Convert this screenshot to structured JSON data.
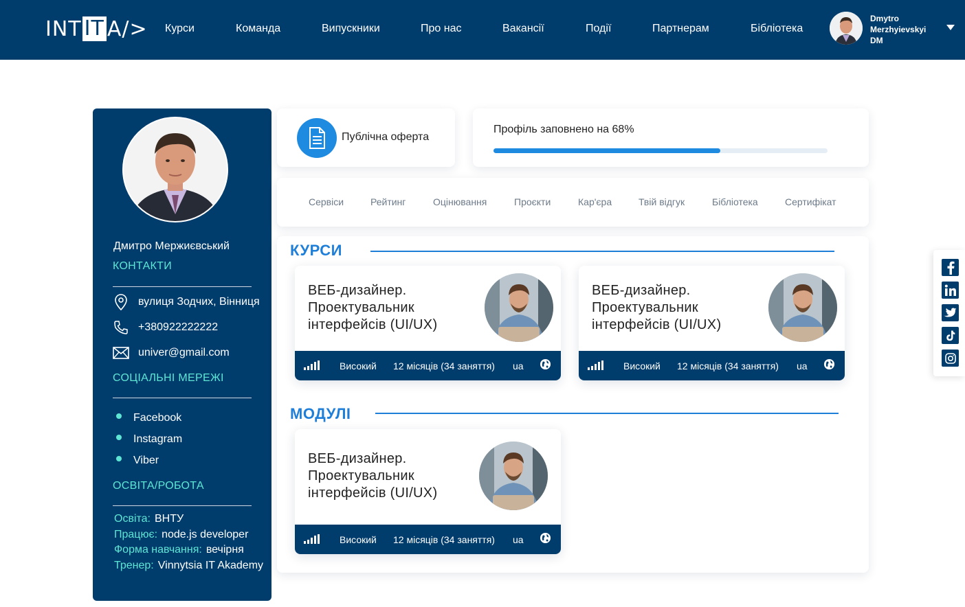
{
  "nav": {
    "logo_left": "INT",
    "logo_box": "IT",
    "logo_right": "A/>",
    "items": [
      "Курси",
      "Команда",
      "Випускники",
      "Про нас",
      "Вакансії",
      "Події",
      "Партнерам",
      "Бібліотека"
    ],
    "user_first": "Dmytro",
    "user_last": "Merzhyievskyi",
    "user_initials": "DM"
  },
  "sidebar": {
    "name": "Дмитро Мержиєвський",
    "contacts_heading": "КОНТАКТИ",
    "address": "вулиця Зодчих, Вінниця",
    "phone": "+380922222222",
    "email": "univer@gmail.com",
    "social_heading": "СОЦІАЛЬНІ МЕРЕЖІ",
    "social": [
      "Facebook",
      "Instagram",
      "Viber"
    ],
    "edu_heading": "ОСВІТА/РОБОТА",
    "info": [
      {
        "label": "Освіта:",
        "value": "ВНТУ"
      },
      {
        "label": "Працює:",
        "value": "node.js developer"
      },
      {
        "label": "Форма навчання:",
        "value": "вечірня"
      },
      {
        "label": "Тренер:",
        "value": "Vinnytsia IT Akademy"
      }
    ]
  },
  "offer": {
    "label": "Публічна оферта"
  },
  "profile": {
    "label": "Профіль заповнено на 68%",
    "percent": 68
  },
  "tabs": [
    "Сервіси",
    "Рейтинг",
    "Оцінювання",
    "Проєкти",
    "Кар'єра",
    "Твій відгук",
    "Бібліотека",
    "Сертифікат"
  ],
  "sections": {
    "courses_title": "КУРСИ",
    "modules_title": "МОДУЛІ"
  },
  "courses": [
    {
      "title": "ВЕБ-дизайнер. Проектувальник інтерфейсів (UI/UX)",
      "level": "Високий",
      "duration": "12 місяців (34 заняття)",
      "lang": "ua"
    },
    {
      "title": "ВЕБ-дизайнер. Проектувальник інтерфейсів (UI/UX)",
      "level": "Високий",
      "duration": "12 місяців (34 заняття)",
      "lang": "ua"
    }
  ],
  "modules": [
    {
      "title": "ВЕБ-дизайнер. Проектувальник інтерфейсів (UI/UX)",
      "level": "Високий",
      "duration": "12 місяців (34 заняття)",
      "lang": "ua"
    }
  ],
  "social_rail": [
    "facebook-icon",
    "linkedin-icon",
    "twitter-icon",
    "tiktok-icon",
    "instagram-icon"
  ],
  "colors": {
    "navy": "#003c6c",
    "accent": "#1f7fd8",
    "teal": "#5ee6d5"
  }
}
